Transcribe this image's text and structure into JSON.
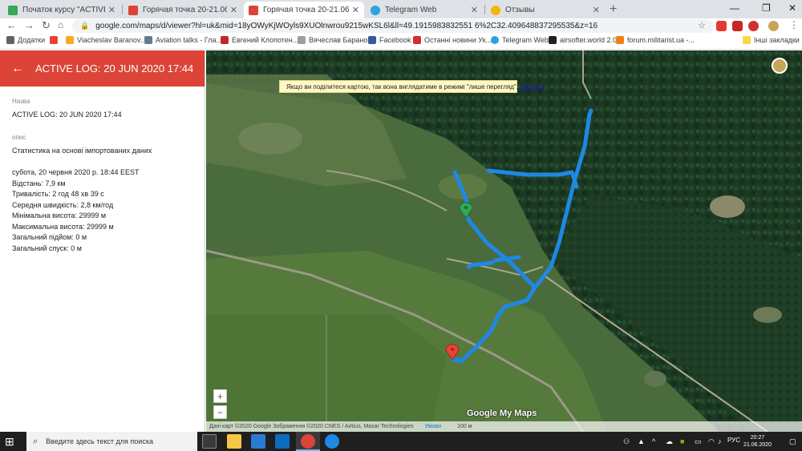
{
  "tabs": [
    {
      "title": "Початок курсу \"ACTIVE LOG: 20 ...",
      "icon": "google-maps-icon",
      "color": "#34a853"
    },
    {
      "title": "Горячая точка 20-21.06.20",
      "icon": "my-maps-icon",
      "color": "#db4437"
    },
    {
      "title": "Горячая точка 20-21.06.20 – Go...",
      "icon": "my-maps-icon",
      "color": "#db4437"
    },
    {
      "title": "Telegram Web",
      "icon": "telegram-icon",
      "color": "#2aa3df"
    },
    {
      "title": "Отзывы",
      "icon": "site-icon",
      "color": "#f2b705"
    }
  ],
  "url": "google.com/maps/d/viewer?hl=uk&mid=18yOWyKjWOyls9XUOlnwrou9215wKSL6l&ll=49.1915983832551 6%2C32.409648837295535&z=16",
  "bookmarks": [
    {
      "label": "Додатки",
      "icon": "apps-icon",
      "color": "#5f6368"
    },
    {
      "label": "",
      "icon": "gmail-icon",
      "color": "#ea4335"
    },
    {
      "label": "Viacheslav Baranov...",
      "icon": "bookmark-icon",
      "color": "#f9a825"
    },
    {
      "label": "Aviation talks - Гла...",
      "icon": "bookmark-icon",
      "color": "#607d8b"
    },
    {
      "label": "Евгений Клопотен...",
      "icon": "bookmark-icon",
      "color": "#c62828"
    },
    {
      "label": "Вячеслав Баранов",
      "icon": "bookmark-icon",
      "color": "#9e9e9e"
    },
    {
      "label": "Facebook",
      "icon": "facebook-icon",
      "color": "#3b5998"
    },
    {
      "label": "Останні новини Ук...",
      "icon": "news-icon",
      "color": "#d32f2f"
    },
    {
      "label": "Telegram Web",
      "icon": "telegram-icon",
      "color": "#2aa3df"
    },
    {
      "label": "airsofter.world 2.0",
      "icon": "bookmark-icon",
      "color": "#212121"
    },
    {
      "label": "forum.militarist.ua -...",
      "icon": "bookmark-icon",
      "color": "#f57f17"
    },
    {
      "label": "Інші закладки",
      "icon": "folder-icon",
      "color": "#f9d648"
    }
  ],
  "panel": {
    "title": "ACTIVE LOG: 20 JUN 2020 17:44",
    "name_label": "Назва",
    "name_value": "ACTIVE LOG: 20 JUN 2020 17:44",
    "desc_label": "опис",
    "desc_value": "Статистика на основі імпортованих даних",
    "stats": [
      "субота, 20 червня 2020 р. 18:44 EEST",
      "Відстань: 7,9 км",
      "Тривалість: 2 год 48 хв 39 с",
      "Середня швидкість: 2,8 км/год",
      "Мінімальна висота: 29999 м",
      "Максимальна висота: 29999 м",
      "Загальний підйом: 0 м",
      "Загальний спуск: 0 м"
    ]
  },
  "map": {
    "banner_text": "Якщо ви поділитеся картою, так вона виглядатиме в режимі \"лише перегляд\".",
    "banner_close": "Закрити",
    "zoom_in": "+",
    "zoom_out": "−",
    "attribution": "Дані карт ©2020 Google Зображення ©2020 CNES / Airbus, Maxar Technologies",
    "terms": "Умови",
    "scale": "100 м",
    "logo": "Google My Maps",
    "track_color": "#1e88e5",
    "start_marker_color": "#34a853",
    "end_marker_color": "#ea4335"
  },
  "taskbar": {
    "search_placeholder": "Введите здесь текст для поиска",
    "lang": "РУС",
    "time": "20:27",
    "date": "21.06.2020"
  }
}
